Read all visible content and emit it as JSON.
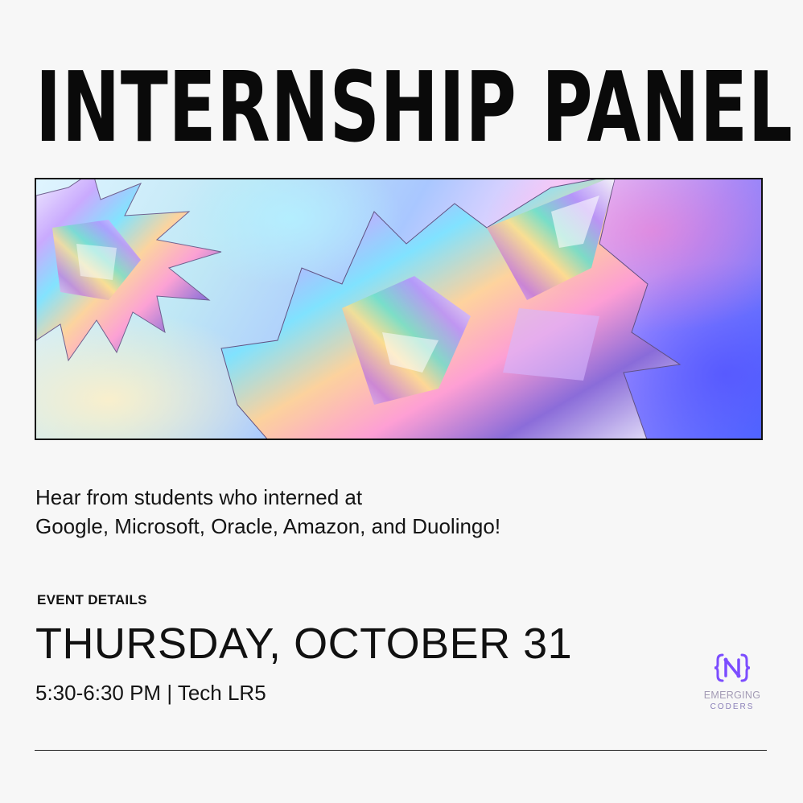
{
  "title": "INTERNSHIP PANEL",
  "description": {
    "line1": "Hear from students who interned at",
    "line2": "Google, Microsoft, Oracle, Amazon, and Duolingo!"
  },
  "event": {
    "label": "EVENT DETAILS",
    "date": "THURSDAY, OCTOBER 31",
    "time_location": "5:30-6:30 PM | Tech LR5"
  },
  "logo": {
    "name": "EMERGING",
    "sub": "CODERS",
    "color": "#7c4dff"
  },
  "hero": {
    "icon": "holographic-crystal-art"
  },
  "colors": {
    "background": "#f7f7f7",
    "text": "#111111",
    "logo_accent": "#7c4dff"
  }
}
